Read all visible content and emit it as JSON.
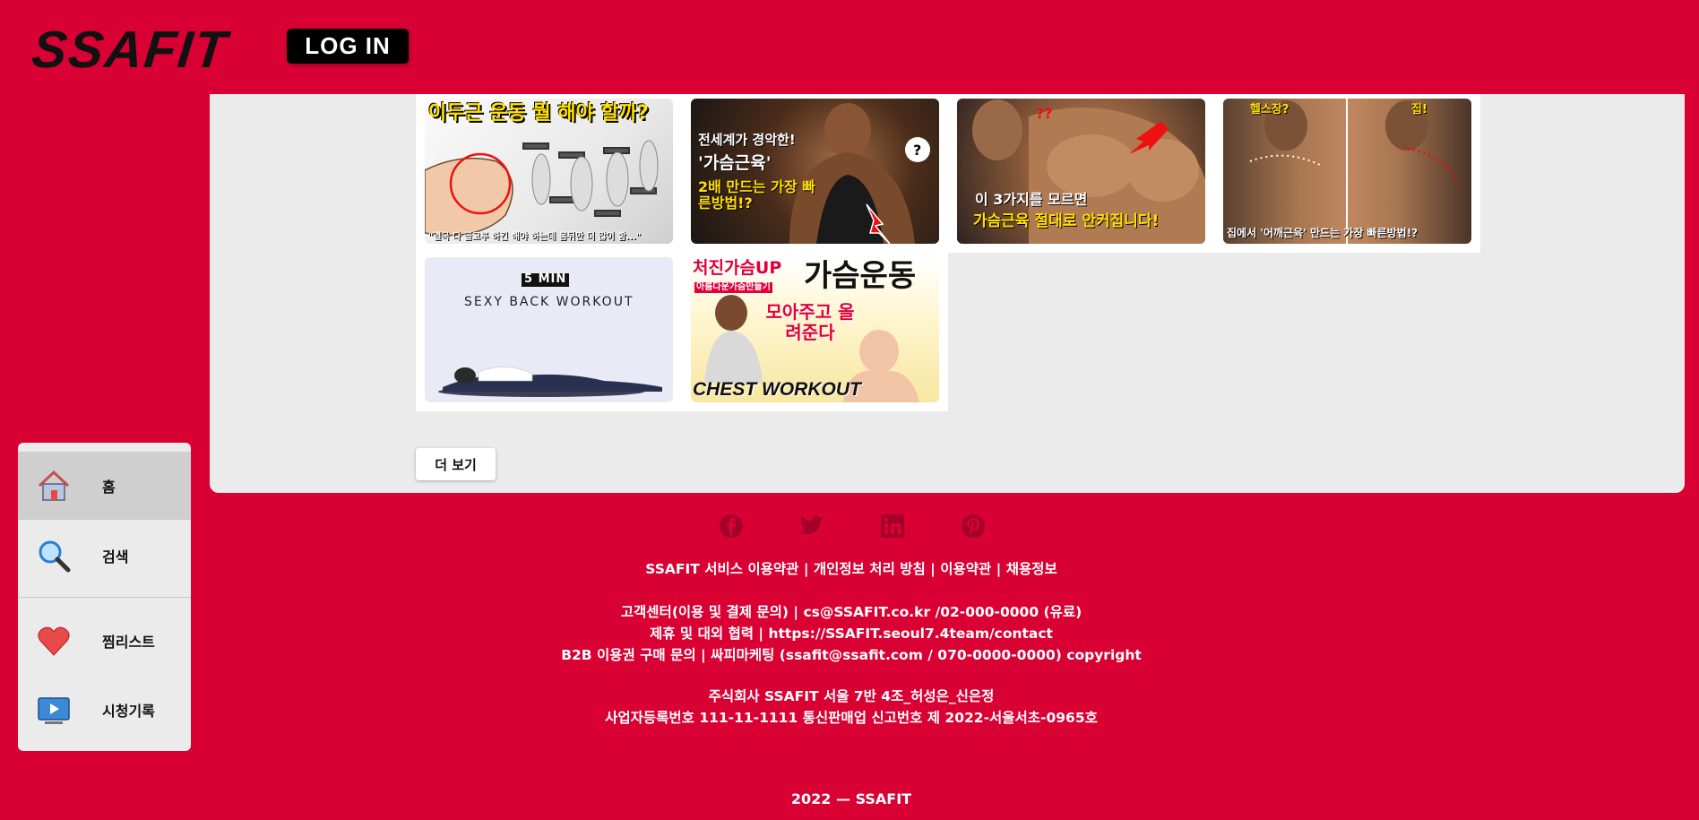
{
  "header": {
    "logo": "SSAFIT",
    "login_label": "LOG IN"
  },
  "videos": [
    {
      "caption_top": "이두근 운동 뭘 해야 할까?",
      "caption_bottom": "\"결국 다 골고루 하긴 해야 하는데 몸뒤만 더 많이 함...\""
    },
    {
      "caption_top": "전세계가 경악한!",
      "caption_mid": "'가슴근육'",
      "caption_bottom": "2배 만드는 가장 빠른방법!?"
    },
    {
      "caption_top": "이 3가지를 모르면",
      "caption_bottom": "가슴근육 절대로 안커집니다!"
    },
    {
      "caption_left": "헬스장?",
      "caption_right": "집!",
      "caption_bottom": "집에서 '어깨근육' 만드는 가장 빠른방법!?"
    },
    {
      "badge": "5 MIN",
      "caption_top": "SEXY BACK WORKOUT"
    },
    {
      "caption_top": "처진가슴UP",
      "caption_sub": "아름다운가슴만들기",
      "caption_big": "가슴운동",
      "caption_mid": "모아주고 올려준다",
      "caption_bottom": "CHEST WORKOUT"
    }
  ],
  "more_label": "더 보기",
  "sidebar": {
    "items": [
      {
        "label": "홈",
        "icon": "home-icon"
      },
      {
        "label": "검색",
        "icon": "search-icon"
      },
      {
        "label": "찜리스트",
        "icon": "heart-icon"
      },
      {
        "label": "시청기록",
        "icon": "history-icon"
      }
    ]
  },
  "footer": {
    "social": [
      "facebook-icon",
      "twitter-icon",
      "linkedin-icon",
      "pinterest-icon"
    ],
    "links": "SSAFIT 서비스 이용약관 | 개인정보 처리 방침 | 이용약관 | 채용정보",
    "contact1": "고객센터(이용 및 결제 문의) | cs@SSAFIT.co.kr /02-000-0000 (유료)",
    "contact2": "제휴 및 대외 협력 | https://SSAFIT.seoul7.4team/contact",
    "contact3": "B2B 이용권 구매 문의 | 싸피마케팅 (ssafit@ssafit.com / 070-0000-0000) copyright",
    "company1": "주식회사 SSAFIT 서울 7반 4조_허성은_신은정",
    "company2": "사업자등록번호 111-11-1111 통신판매업 신고번호 제 2022-서울서초-0965호",
    "copyright": "2022 — SSAFIT"
  },
  "colors": {
    "brand": "#d90033",
    "panel": "#ebebeb"
  }
}
